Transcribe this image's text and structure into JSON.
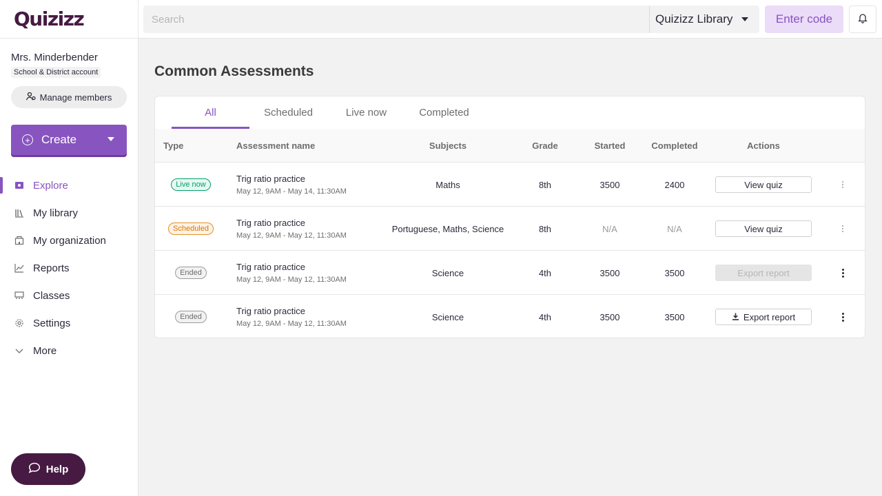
{
  "app": {
    "logo": "Quizizz"
  },
  "user": {
    "name": "Mrs. Minderbender",
    "account_type": "School & District account",
    "manage_label": "Manage members"
  },
  "create": {
    "label": "Create"
  },
  "nav": {
    "items": [
      {
        "label": "Explore",
        "icon": "compass-icon",
        "active": true
      },
      {
        "label": "My library",
        "icon": "library-icon"
      },
      {
        "label": "My organization",
        "icon": "building-icon"
      },
      {
        "label": "Reports",
        "icon": "chart-icon"
      },
      {
        "label": "Classes",
        "icon": "classroom-icon"
      },
      {
        "label": "Settings",
        "icon": "gear-icon"
      },
      {
        "label": "More",
        "icon": "chevron-down-icon"
      }
    ]
  },
  "help": {
    "label": "Help"
  },
  "topbar": {
    "search_placeholder": "Search",
    "library_label": "Quizizz Library",
    "enter_code_label": "Enter code"
  },
  "page": {
    "title": "Common Assessments"
  },
  "tabs": [
    {
      "label": "All",
      "active": true
    },
    {
      "label": "Scheduled"
    },
    {
      "label": "Live now"
    },
    {
      "label": "Completed"
    }
  ],
  "table": {
    "columns": [
      "Type",
      "Assessment name",
      "Subjects",
      "Grade",
      "Started",
      "Completed",
      "Actions"
    ],
    "rows": [
      {
        "type": "Live now",
        "status": "live",
        "name": "Trig ratio practice",
        "dates": "May 12, 9AM - May 14, 11:30AM",
        "subjects": "Maths",
        "grade": "8th",
        "started": "3500",
        "completed": "2400",
        "action": "View quiz",
        "action_disabled": false
      },
      {
        "type": "Scheduled",
        "status": "scheduled",
        "name": "Trig ratio practice",
        "dates": "May 12, 9AM - May 12, 11:30AM",
        "subjects": "Portuguese, Maths, Science",
        "grade": "8th",
        "started": "N/A",
        "completed": "N/A",
        "action": "View quiz",
        "action_disabled": false
      },
      {
        "type": "Ended",
        "status": "ended",
        "name": "Trig ratio practice",
        "dates": "May 12, 9AM - May 12, 11:30AM",
        "subjects": "Science",
        "grade": "4th",
        "started": "3500",
        "completed": "3500",
        "action": "Export report",
        "action_disabled": true
      },
      {
        "type": "Ended",
        "status": "ended",
        "name": "Trig ratio practice",
        "dates": "May 12, 9AM - May 12, 11:30AM",
        "subjects": "Science",
        "grade": "4th",
        "started": "3500",
        "completed": "3500",
        "action": "Export report",
        "action_disabled": false
      }
    ]
  },
  "colors": {
    "brand_purple": "#8854c0",
    "brand_dark": "#461a42",
    "live_green": "#00a06a",
    "scheduled_orange": "#d9770b"
  }
}
